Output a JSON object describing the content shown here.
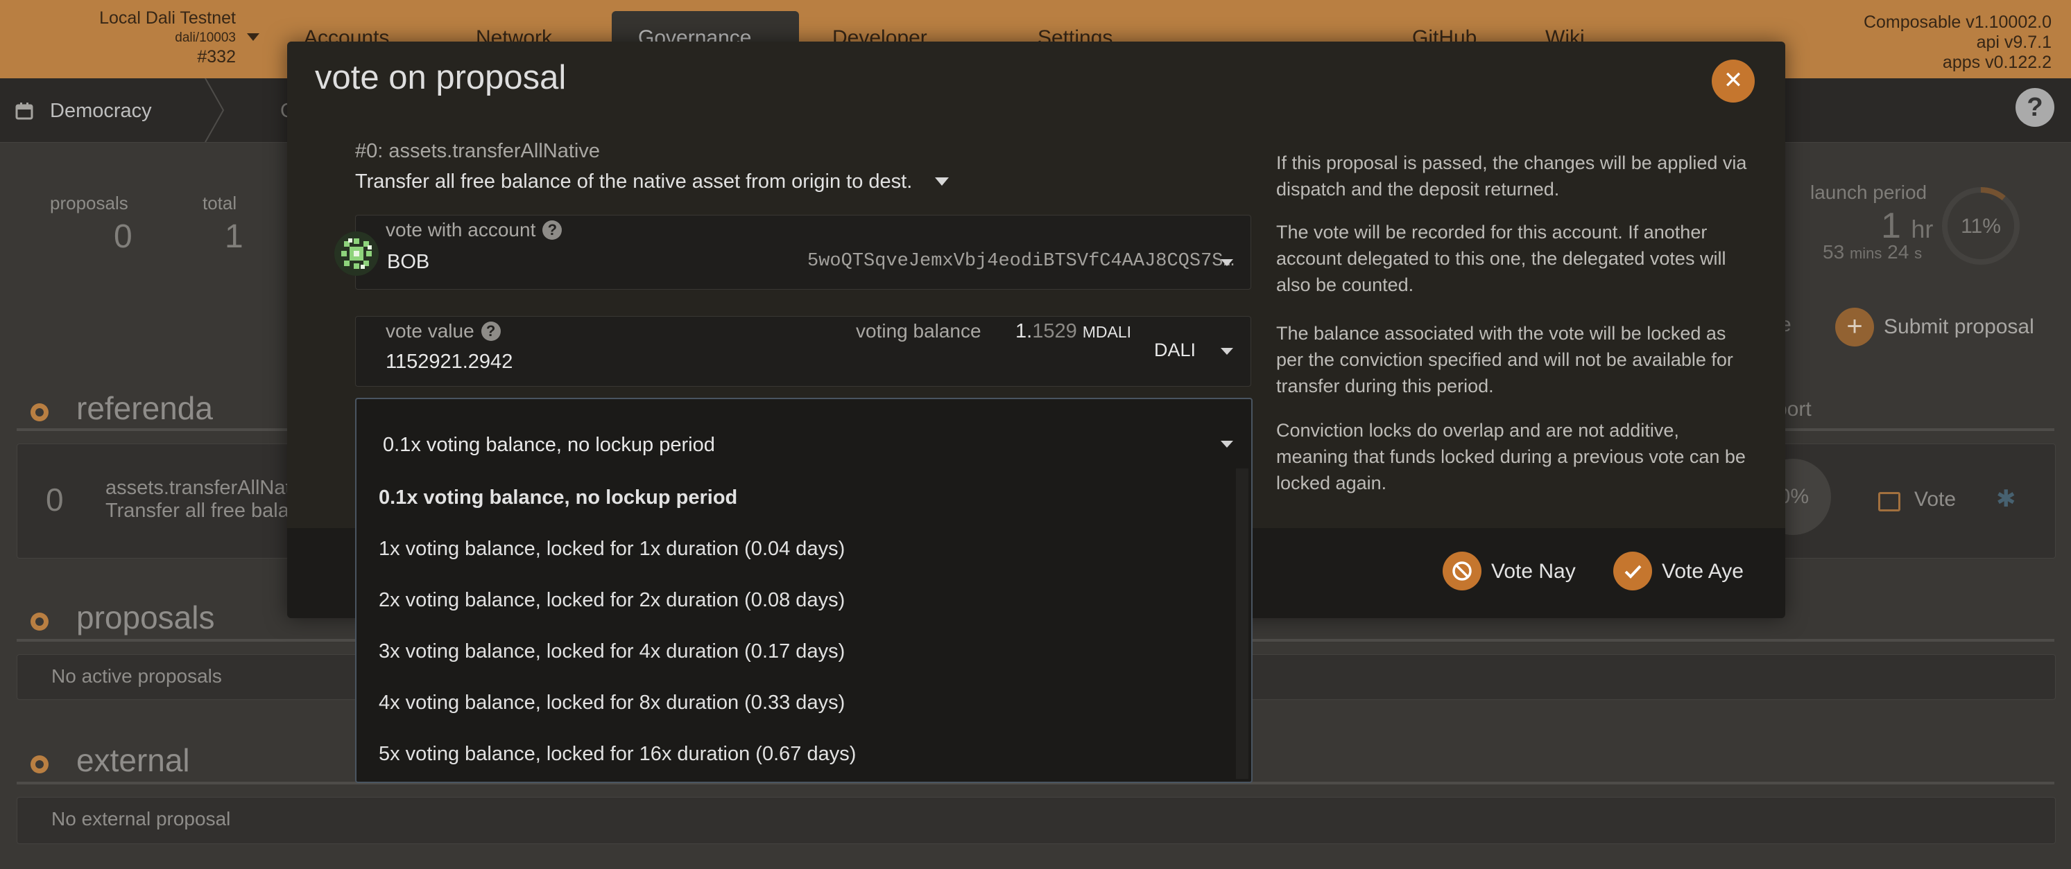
{
  "topbar": {
    "chain_name": "Local Dali Testnet",
    "chain_spec": "dali/10003",
    "block": "#332",
    "menu": [
      "Accounts",
      "Network",
      "Governance",
      "Developer",
      "Settings"
    ],
    "links": [
      "GitHub",
      "Wiki"
    ],
    "versions": [
      "Composable v1.10002.0",
      "api v9.7.1",
      "apps v0.122.2"
    ]
  },
  "subnav": {
    "current": "Democracy",
    "partial_next": "C"
  },
  "stats": {
    "proposals_label": "proposals",
    "proposals_value": "0",
    "total_label": "total",
    "total_value": "1",
    "launch_label": "launch period",
    "launch_hr": "1",
    "launch_hr_unit": "hr",
    "launch_min": "53",
    "launch_min_unit": "mins",
    "launch_sec": "24",
    "launch_sec_unit": "s",
    "launch_pct": "11%",
    "launch_fraction": 0.11,
    "submit_label": "Submit proposal",
    "partial_e": "e"
  },
  "sections": {
    "referenda": "referenda",
    "proposals": "proposals",
    "external": "external",
    "ref_index": "0",
    "ref_name": "assets.transferAllNat",
    "ref_desc": "Transfer all free bala",
    "ref_pct_partial": "0%",
    "ref_vote": "Vote",
    "support_partial": "port",
    "no_proposals": "No active proposals",
    "no_external": "No external proposal"
  },
  "modal": {
    "title": "vote on proposal",
    "proposal_id": "#0: assets.transferAllNative",
    "proposal_desc": "Transfer all free balance of the native asset from origin to dest.",
    "account_label": "vote with account",
    "account_name": "BOB",
    "account_address": "5woQTSqveJemxVbj4eodiBTSVfC4AAJ8CQS7S…",
    "value_label": "vote value",
    "value": "1152921.2942",
    "voting_balance_label": "voting balance",
    "balance_whole": "1.",
    "balance_decimals": "1529",
    "balance_unit": "MDALI",
    "token": "DALI",
    "conviction_selected": "0.1x voting balance, no lockup period",
    "conviction_options": [
      "0.1x voting balance, no lockup period",
      "1x voting balance, locked for 1x duration (0.04 days)",
      "2x voting balance, locked for 2x duration (0.08 days)",
      "3x voting balance, locked for 4x duration (0.17 days)",
      "4x voting balance, locked for 8x duration (0.33 days)",
      "5x voting balance, locked for 16x duration (0.67 days)"
    ],
    "help": [
      "If this proposal is passed, the changes will be applied via dispatch and the deposit returned.",
      "The vote will be recorded for this account. If another account delegated to this one, the delegated votes will also be counted.",
      "The balance associated with the vote will be locked as per the conviction specified and will not be available for transfer during this period.",
      "Conviction locks do overlap and are not additive, meaning that funds locked during a previous vote can be locked again."
    ],
    "vote_nay": "Vote Nay",
    "vote_aye": "Vote Aye"
  },
  "colors": {
    "accent": "#c5762e",
    "topbar": "#c98a48",
    "modal_bg": "#26241f"
  }
}
